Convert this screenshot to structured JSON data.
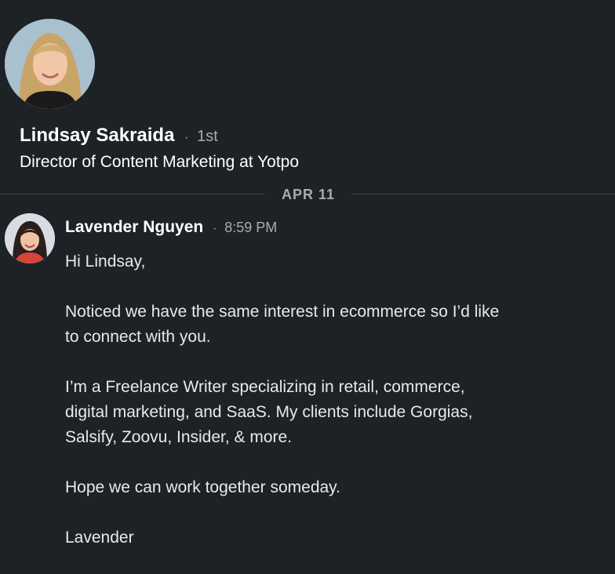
{
  "profile": {
    "name": "Lindsay Sakraida",
    "separator": "·",
    "degree": "1st",
    "headline": "Director of Content Marketing at Yotpo",
    "avatar_icon": "profile-photo"
  },
  "thread": {
    "date_label": "APR 11"
  },
  "message": {
    "sender": "Lavender Nguyen",
    "separator": "·",
    "time": "8:59 PM",
    "avatar_icon": "sender-photo",
    "lines": {
      "greeting": "Hi Lindsay,",
      "p1_l1": "Noticed we have the same interest in ecommerce so I’d like",
      "p1_l2": "to connect with you.",
      "p2_l1": "I’m a Freelance Writer specializing in retail, commerce,",
      "p2_l2": "digital marketing, and SaaS. My clients include Gorgias,",
      "p2_l3": "Salsify, Zoovu, Insider, & more.",
      "p3_l1": "Hope we can work together someday.",
      "signoff": "Lavender"
    }
  },
  "colors": {
    "background": "#1d2226",
    "text_primary": "#ffffff",
    "text_secondary": "#a8acaf",
    "divider": "#3a3f44"
  }
}
